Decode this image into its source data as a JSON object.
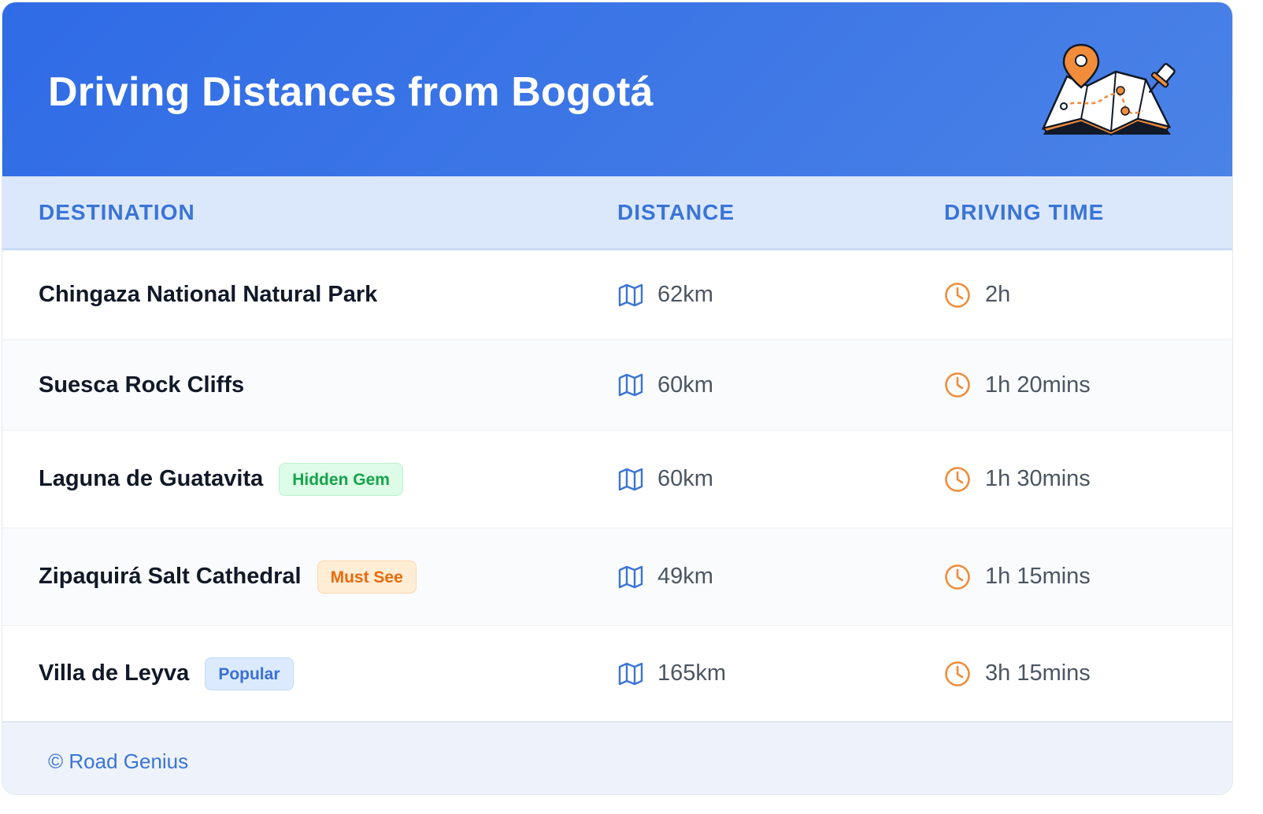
{
  "header": {
    "title": "Driving Distances from Bogotá",
    "illustration": "map-with-pins-icon"
  },
  "table": {
    "columns": [
      "DESTINATION",
      "DISTANCE",
      "DRIVING TIME"
    ],
    "rows": [
      {
        "destination": "Chingaza National Natural Park",
        "badge": null,
        "distance": "62km",
        "time": "2h"
      },
      {
        "destination": "Suesca Rock Cliffs",
        "badge": null,
        "distance": "60km",
        "time": "1h 20mins"
      },
      {
        "destination": "Laguna de Guatavita",
        "badge": "Hidden Gem",
        "distance": "60km",
        "time": "1h 30mins"
      },
      {
        "destination": "Zipaquirá Salt Cathedral",
        "badge": "Must See",
        "distance": "49km",
        "time": "1h 15mins"
      },
      {
        "destination": "Villa de Leyva",
        "badge": "Popular",
        "distance": "165km",
        "time": "3h 15mins"
      }
    ]
  },
  "footer": {
    "text": "© Road Genius"
  },
  "colors": {
    "header_bg": "#2f6be6",
    "accent_blue": "#3a74d6",
    "accent_orange": "#f08c3a",
    "badge_green": "#16a34a",
    "badge_orange": "#ea6a0c",
    "badge_blue": "#3b6fd6"
  },
  "icons": {
    "distance": "map-icon",
    "time": "clock-icon"
  }
}
